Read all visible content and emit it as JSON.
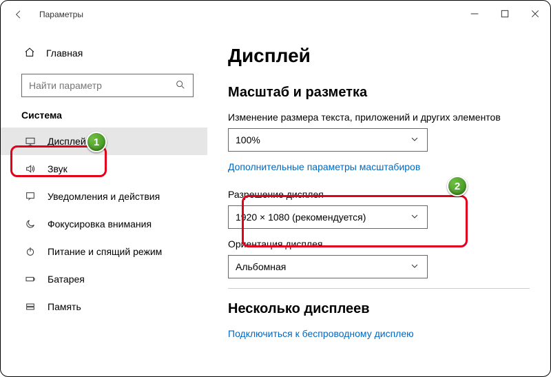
{
  "window": {
    "title": "Параметры"
  },
  "sidebar": {
    "home": "Главная",
    "search_placeholder": "Найти параметр",
    "section": "Система",
    "items": [
      {
        "label": "Дисплей"
      },
      {
        "label": "Звук"
      },
      {
        "label": "Уведомления и действия"
      },
      {
        "label": "Фокусировка внимания"
      },
      {
        "label": "Питание и спящий режим"
      },
      {
        "label": "Батарея"
      },
      {
        "label": "Память"
      }
    ]
  },
  "content": {
    "title": "Дисплей",
    "scale_heading": "Масштаб и разметка",
    "scale_label": "Изменение размера текста, приложений и других элементов",
    "scale_value": "100%",
    "scale_link": "Дополнительные параметры масштабиров",
    "resolution_label": "Разрешение дисплея",
    "resolution_value": "1920 × 1080 (рекомендуется)",
    "orientation_label": "Ориентация дисплея",
    "orientation_value": "Альбомная",
    "multi_heading": "Несколько дисплеев",
    "multi_link": "Подключиться к беспроводному дисплею"
  },
  "annotations": {
    "one": "1",
    "two": "2"
  }
}
